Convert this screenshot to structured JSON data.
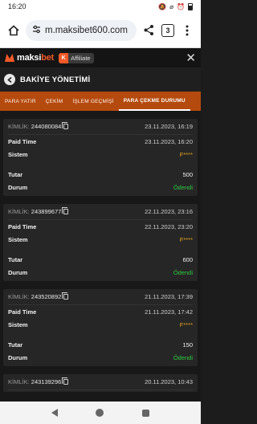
{
  "status_bar": {
    "time": "16:20",
    "icons": [
      "mute-icon",
      "wifi-off-icon",
      "alarm-icon",
      "battery-icon"
    ]
  },
  "browser": {
    "url": "m.maksibet600.com",
    "tab_count": "3"
  },
  "site": {
    "logo_prefix": "maksi",
    "logo_suffix": "bet",
    "affiliate_badge": "K",
    "affiliate_label": "Affiliate",
    "accent_color": "#f05a28"
  },
  "page": {
    "title": "BAKİYE YÖNETİMİ"
  },
  "tabs": [
    {
      "label": "PARA YATIR",
      "active": false
    },
    {
      "label": "ÇEKİM",
      "active": false
    },
    {
      "label": "İŞLEM GEÇMİŞİ",
      "active": false
    },
    {
      "label": "PARA ÇEKME DURUMU",
      "active": true
    }
  ],
  "labels": {
    "id_prefix": "KİMLİK:",
    "paid_time": "Paid Time",
    "system": "Sistem",
    "amount": "Tutar",
    "status": "Durum"
  },
  "records": [
    {
      "id": "244080084",
      "date": "23.11.2023, 16:19",
      "paid_time": "23.11.2023, 16:20",
      "system": "F****",
      "amount": "500",
      "status": "Ödendi"
    },
    {
      "id": "243899677",
      "date": "22.11.2023, 23:16",
      "paid_time": "22.11.2023, 23:20",
      "system": "F****",
      "amount": "600",
      "status": "Ödendi"
    },
    {
      "id": "243520892",
      "date": "21.11.2023, 17:39",
      "paid_time": "21.11.2023, 17:42",
      "system": "F****",
      "amount": "150",
      "status": "Ödendi"
    },
    {
      "id": "243139296",
      "date": "20.11.2023, 10:43"
    }
  ]
}
